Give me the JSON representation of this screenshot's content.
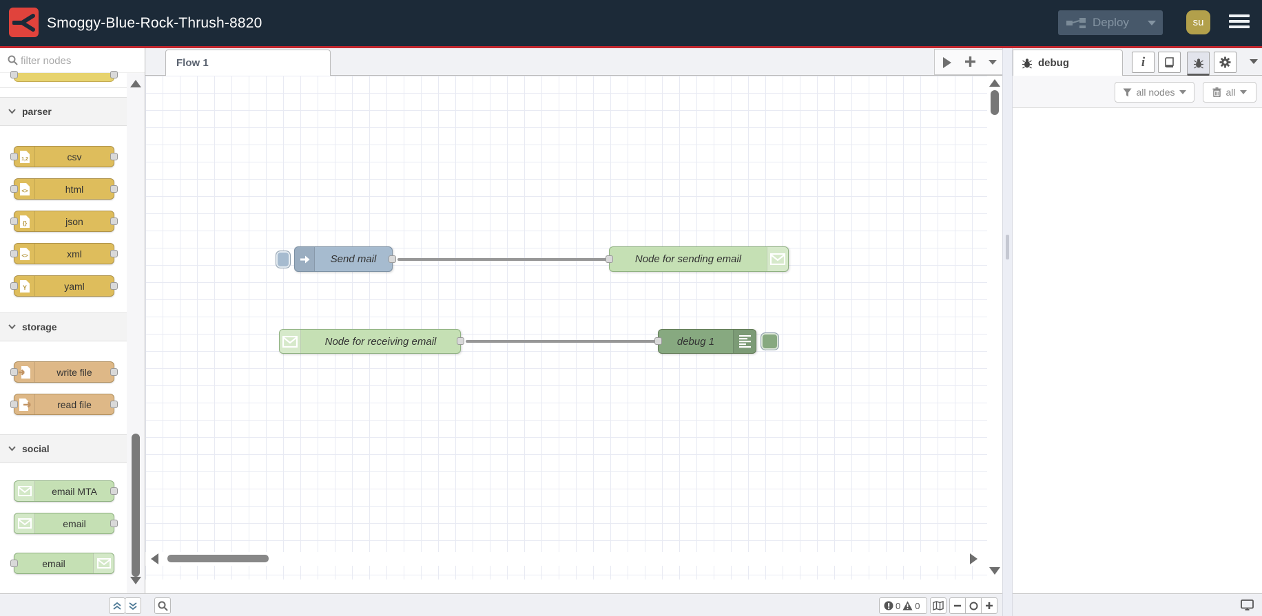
{
  "header": {
    "title": "Smoggy-Blue-Rock-Thrush-8820",
    "deploy": {
      "label": "Deploy"
    },
    "user": {
      "initials": "su"
    }
  },
  "palette": {
    "filter_placeholder": "filter nodes",
    "categories": [
      {
        "label": "parser",
        "items": [
          {
            "label": "csv",
            "glyph": "1,2"
          },
          {
            "label": "html",
            "glyph": "<>"
          },
          {
            "label": "json",
            "glyph": "{}"
          },
          {
            "label": "xml",
            "glyph": "<>"
          },
          {
            "label": "yaml",
            "glyph": "Y"
          }
        ]
      },
      {
        "label": "storage",
        "items": [
          {
            "label": "write file"
          },
          {
            "label": "read file"
          }
        ]
      },
      {
        "label": "social",
        "items": [
          {
            "label": "email MTA"
          },
          {
            "label": "email"
          },
          {
            "label": "email"
          }
        ]
      }
    ]
  },
  "workspace": {
    "tab_label": "Flow 1"
  },
  "flow": {
    "inject_node": {
      "label": "Send mail"
    },
    "send_node": {
      "label": "Node for sending email"
    },
    "receive_node": {
      "label": "Node for receiving email"
    },
    "debug_node": {
      "label": "debug 1"
    }
  },
  "sidebar": {
    "tab_label": "debug",
    "info_glyph": "i",
    "filter_button": "all nodes",
    "clear_button": "all"
  },
  "statusbar": {
    "errors": "0",
    "warnings": "0"
  },
  "colors": {
    "header_bg": "#1c2a38",
    "accent_red": "#c3272e",
    "logo_red": "#e0433c",
    "inject_blue": "#a6bbcf",
    "email_green": "#c5e0b4",
    "debug_green": "#87a980",
    "parser_yellow": "#debd5c",
    "storage_tan": "#deb887",
    "avatar_gold": "#b2a04b",
    "wire_gray": "#979797"
  }
}
